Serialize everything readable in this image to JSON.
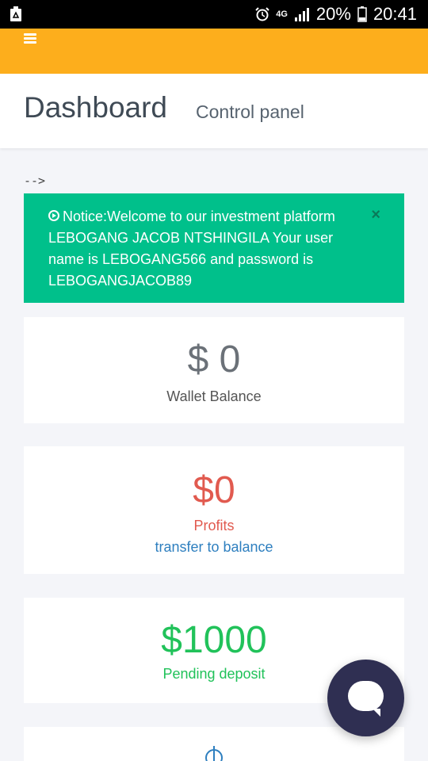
{
  "status_bar": {
    "network": "4G",
    "battery": "20%",
    "time": "20:41",
    "icons": [
      "recycle-icon",
      "alarm-icon",
      "network-4g-icon",
      "signal-icon",
      "battery-icon"
    ]
  },
  "header": {
    "title": "Dashboard",
    "subtitle": "Control panel"
  },
  "arrow_text": "-->",
  "notice": {
    "prefix": "Notice:",
    "message": "Welcome to our investment platform LEBOGANG JACOB NTSHINGILA Your user name is LEBOGANG566 and password is LEBOGANGJACOB89",
    "close": "×"
  },
  "cards": {
    "wallet": {
      "amount": "$ 0",
      "label": "Wallet Balance"
    },
    "profits": {
      "amount": "$0",
      "label": "Profits",
      "link": "transfer to balance"
    },
    "pending": {
      "amount": "$1000",
      "label": "Pending deposit"
    }
  },
  "colors": {
    "appbar": "#fdae1c",
    "notice": "#00c08b",
    "profit": "#e15a4f",
    "pending": "#21c25a",
    "link": "#2e7fbf",
    "chat": "#2f2f52"
  }
}
